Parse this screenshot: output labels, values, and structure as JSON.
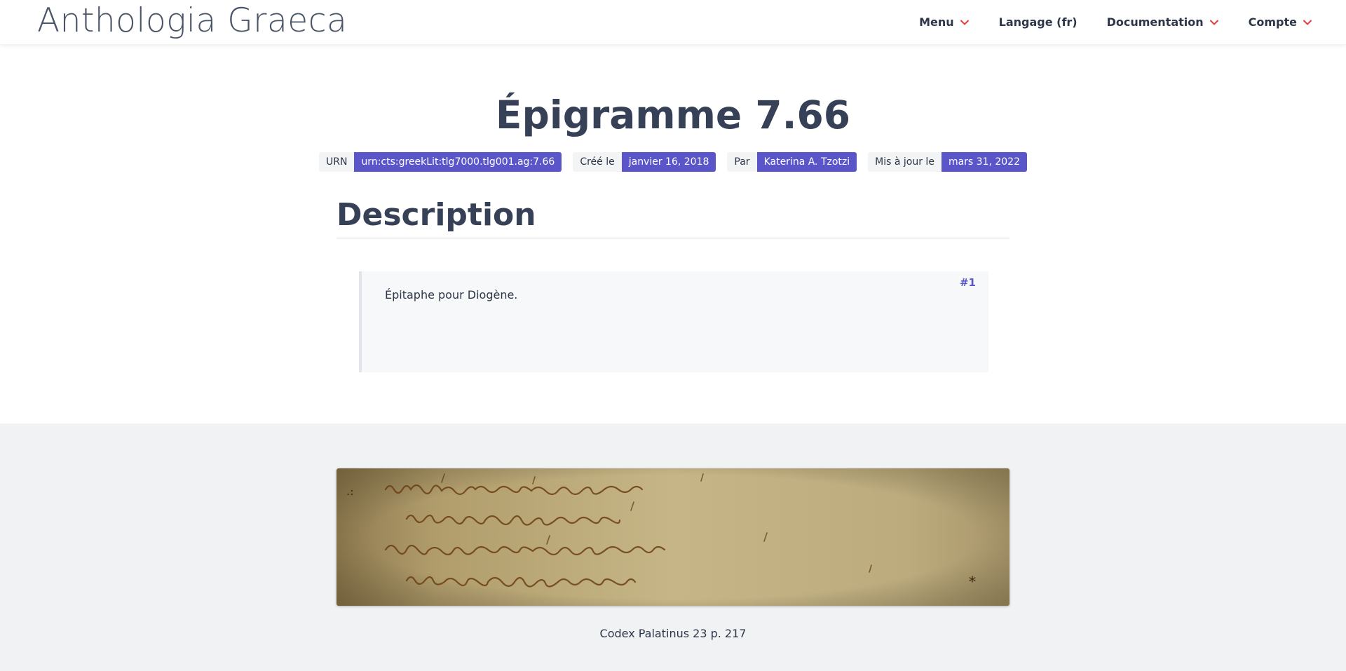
{
  "header": {
    "brand": "Anthologia Graeca",
    "nav": [
      {
        "label": "Menu",
        "has_dropdown": true
      },
      {
        "label": "Langage (fr)",
        "has_dropdown": false
      },
      {
        "label": "Documentation",
        "has_dropdown": true
      },
      {
        "label": "Compte",
        "has_dropdown": true
      }
    ],
    "accent_color": "#e53e3e"
  },
  "epigram": {
    "title": "Épigramme 7.66",
    "meta": {
      "urn_label": "URN",
      "urn_value": "urn:cts:greekLit:tlg7000.tlg001.ag:7.66",
      "created_label": "Créé le",
      "created_value": "janvier 16, 2018",
      "author_label": "Par",
      "author_value": "Katerina A. Tzotzi",
      "updated_label": "Mis à jour le",
      "updated_value": "mars 31, 2022"
    },
    "badge_color": "#5a55c8"
  },
  "description": {
    "heading": "Description",
    "items": [
      {
        "text": "Épitaphe pour Diogène.",
        "anchor": "#1"
      }
    ]
  },
  "manuscript": {
    "caption": "Codex Palatinus 23 p. 217",
    "icon": "manuscript-image"
  }
}
